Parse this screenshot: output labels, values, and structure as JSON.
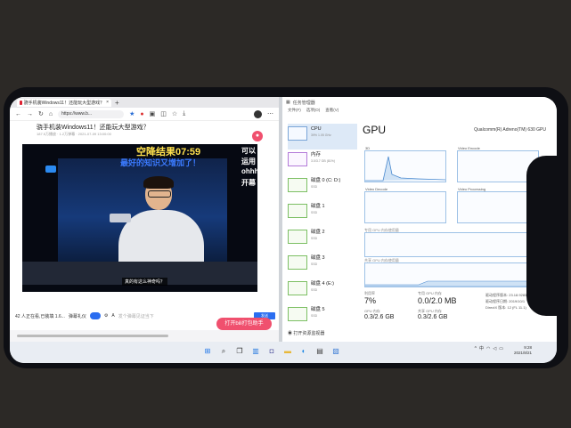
{
  "browser": {
    "tab_title": "骁手机装Windows11！还能玩大型游戏？",
    "url": "https://www.b...",
    "page_title": "骁手机装Windows11！还能玩大型游戏？",
    "page_meta": "187.5万播放 · 1.2万弹幕 · 2021-07-09 13:00:00",
    "video": {
      "counter": "空降结果07:59",
      "subtitle": "最好的知识又增加了！",
      "caption": "真的有这么神奇吗？",
      "side_text": [
        "可以",
        "运用",
        "ohhh",
        "开幕"
      ]
    },
    "comment_bar": {
      "count_text": "42 人正在看,已装填 1.6...",
      "hint": "弹幕礼仪",
      "placeholder": "发个弹幕见证当下",
      "send_label": "发送"
    },
    "open_app_label": "打开bili打包助手"
  },
  "taskmgr": {
    "window_title": "任务管理器",
    "menu": [
      "文件(F)",
      "选项(O)",
      "查看(V)"
    ],
    "sidebar": [
      {
        "label": "CPU",
        "sub": "39% 1.05 GHz",
        "kind": "cpu"
      },
      {
        "label": "内存",
        "sub": "3.0/3.7 GB (81%)",
        "kind": "mem"
      },
      {
        "label": "磁盘 0 (C: D:)",
        "sub": "SSD",
        "kind": "disk"
      },
      {
        "label": "磁盘 1",
        "sub": "SSD",
        "kind": "disk"
      },
      {
        "label": "磁盘 2",
        "sub": "SSD",
        "kind": "disk"
      },
      {
        "label": "磁盘 3",
        "sub": "SSD",
        "kind": "disk"
      },
      {
        "label": "磁盘 4 (E:)",
        "sub": "SSD",
        "kind": "disk"
      },
      {
        "label": "磁盘 5",
        "sub": "SSD",
        "kind": "disk"
      }
    ],
    "gpu_title": "GPU",
    "gpu_model": "Qualcomm(R) Adreno(TM) 630 GPU",
    "engines": [
      "3D",
      "Video Encode",
      "Video Decode",
      "Video Processing"
    ],
    "long_graphs": [
      "共享 GPU 内存使用量",
      "专用 GPU 内存使用量"
    ],
    "stats": {
      "util_label": "利用率",
      "util_value": "7%",
      "mem_label": "专用 GPU 内存",
      "mem_value": "0.0/2.0 MB",
      "gpu_mem_label": "GPU 内存",
      "gpu_mem_value": "0.3/2.6 GB",
      "shared_label": "共享 GPU 内存",
      "shared_value": "0.3/2.6 GB",
      "driver_version_label": "驱动程序版本:",
      "driver_version": "23.18.9283.0",
      "driver_date_label": "驱动程序日期:",
      "driver_date": "2019/10/1",
      "directx_label": "DirectX 版本:",
      "directx": "12 (FL 11.1)"
    },
    "footer": "打开资源监视器"
  },
  "taskbar": {
    "clock_time": "9:28",
    "clock_date": "2021/8/21",
    "lang": "中"
  }
}
